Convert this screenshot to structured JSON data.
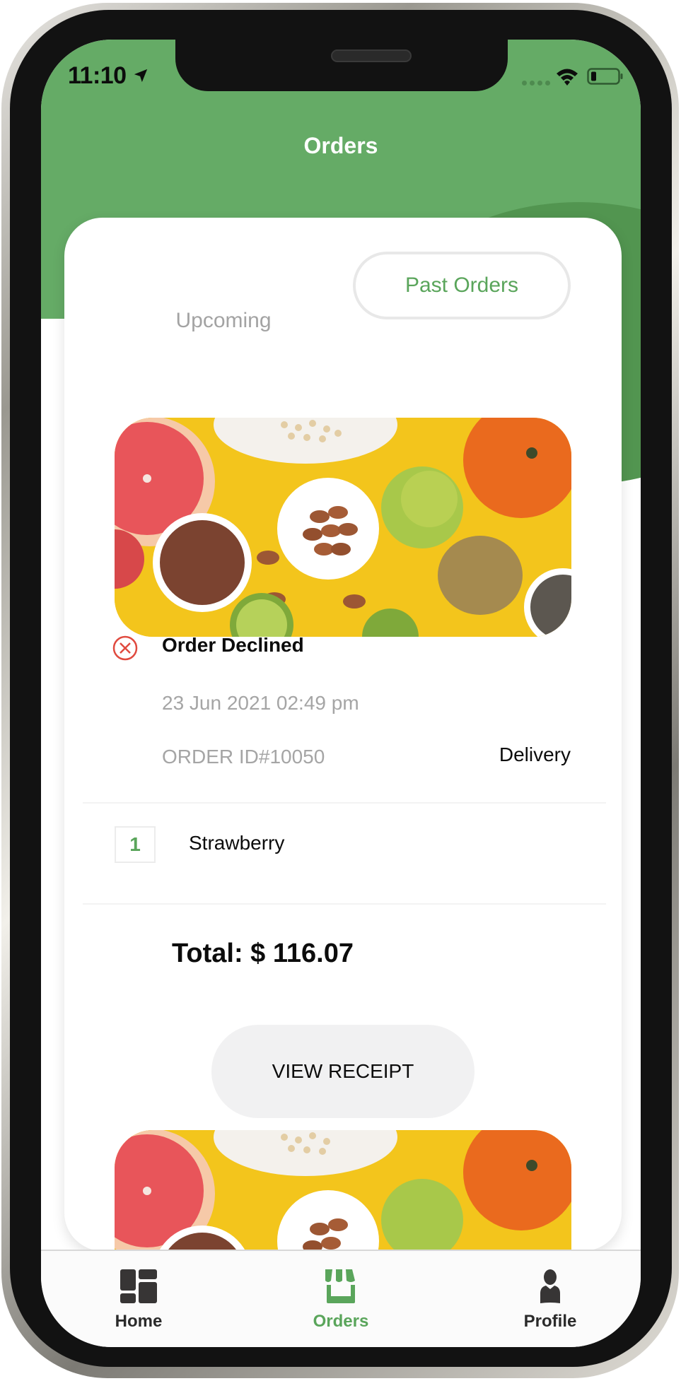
{
  "status_bar": {
    "time": "11:10",
    "location_icon": "location-arrow-icon",
    "signal_icon": "signal-dots-icon",
    "wifi_icon": "wifi-icon",
    "battery_icon": "battery-icon"
  },
  "header": {
    "title": "Orders"
  },
  "tabs": [
    {
      "label": "Upcoming",
      "active": false
    },
    {
      "label": "Past Orders",
      "active": true
    }
  ],
  "orders": [
    {
      "image": "fruits-and-nuts-photo",
      "status": "Order Declined",
      "status_icon": "x-circle-icon",
      "date": "23 Jun 2021 02:49 pm",
      "order_id": "ORDER ID#10050",
      "type": "Delivery",
      "items": [
        {
          "qty": "1",
          "name": "Strawberry"
        }
      ],
      "total": "Total: $ 116.07",
      "receipt_button": "VIEW RECEIPT"
    },
    {
      "image": "fruits-and-nuts-photo"
    }
  ],
  "bottom_nav": [
    {
      "label": "Home",
      "icon": "dashboard-icon",
      "active": false
    },
    {
      "label": "Orders",
      "icon": "store-icon",
      "active": true
    },
    {
      "label": "Profile",
      "icon": "user-icon",
      "active": false
    }
  ],
  "colors": {
    "brand_green": "#65ab66",
    "accent_green": "#5aa55b",
    "declined_red": "#e04a3f",
    "muted_text": "#a5a5a5"
  }
}
